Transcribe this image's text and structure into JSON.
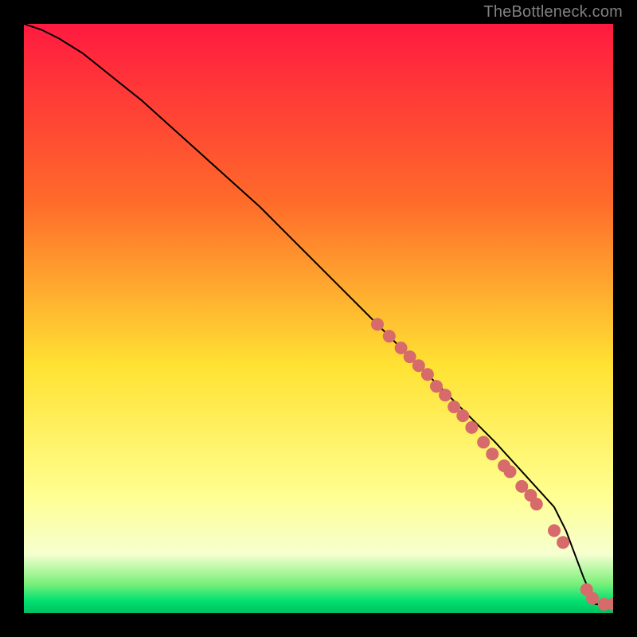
{
  "attribution": "TheBottleneck.com",
  "chart_data": {
    "type": "line",
    "title": "",
    "xlabel": "",
    "ylabel": "",
    "x": [
      0,
      3,
      6,
      10,
      15,
      20,
      25,
      30,
      35,
      40,
      45,
      50,
      55,
      60,
      65,
      70,
      75,
      80,
      85,
      90,
      92,
      95,
      97,
      100
    ],
    "values": [
      100,
      99,
      97.5,
      95,
      91,
      87,
      82.5,
      78,
      73.5,
      69,
      64,
      59,
      54,
      49,
      44,
      39,
      34,
      29,
      23.5,
      18,
      14,
      6,
      1.5,
      1.5
    ],
    "xlim": [
      0,
      100
    ],
    "ylim": [
      0,
      100
    ],
    "gradient": {
      "top": "#ff1a40",
      "upper_mid": "#ff6a2a",
      "mid": "#ffe233",
      "lower_mid": "#ffff90",
      "band_top": "#f6ffd0",
      "band_g1": "#7af07a",
      "band_g2": "#00e070",
      "bottom": "#00c060"
    },
    "markers": {
      "color": "#d76a6a",
      "radius": 8,
      "points_xy": [
        [
          60,
          49
        ],
        [
          62,
          47
        ],
        [
          64,
          45
        ],
        [
          65.5,
          43.5
        ],
        [
          67,
          42
        ],
        [
          68.5,
          40.5
        ],
        [
          70,
          38.5
        ],
        [
          71.5,
          37
        ],
        [
          73,
          35
        ],
        [
          74.5,
          33.5
        ],
        [
          76,
          31.5
        ],
        [
          78,
          29
        ],
        [
          79.5,
          27
        ],
        [
          81.5,
          25
        ],
        [
          82.5,
          24
        ],
        [
          84.5,
          21.5
        ],
        [
          86,
          20
        ],
        [
          87,
          18.5
        ],
        [
          90,
          14
        ],
        [
          91.5,
          12
        ],
        [
          95.5,
          4
        ],
        [
          96.5,
          2.5
        ],
        [
          98.5,
          1.5
        ],
        [
          100,
          1.5
        ]
      ]
    }
  }
}
